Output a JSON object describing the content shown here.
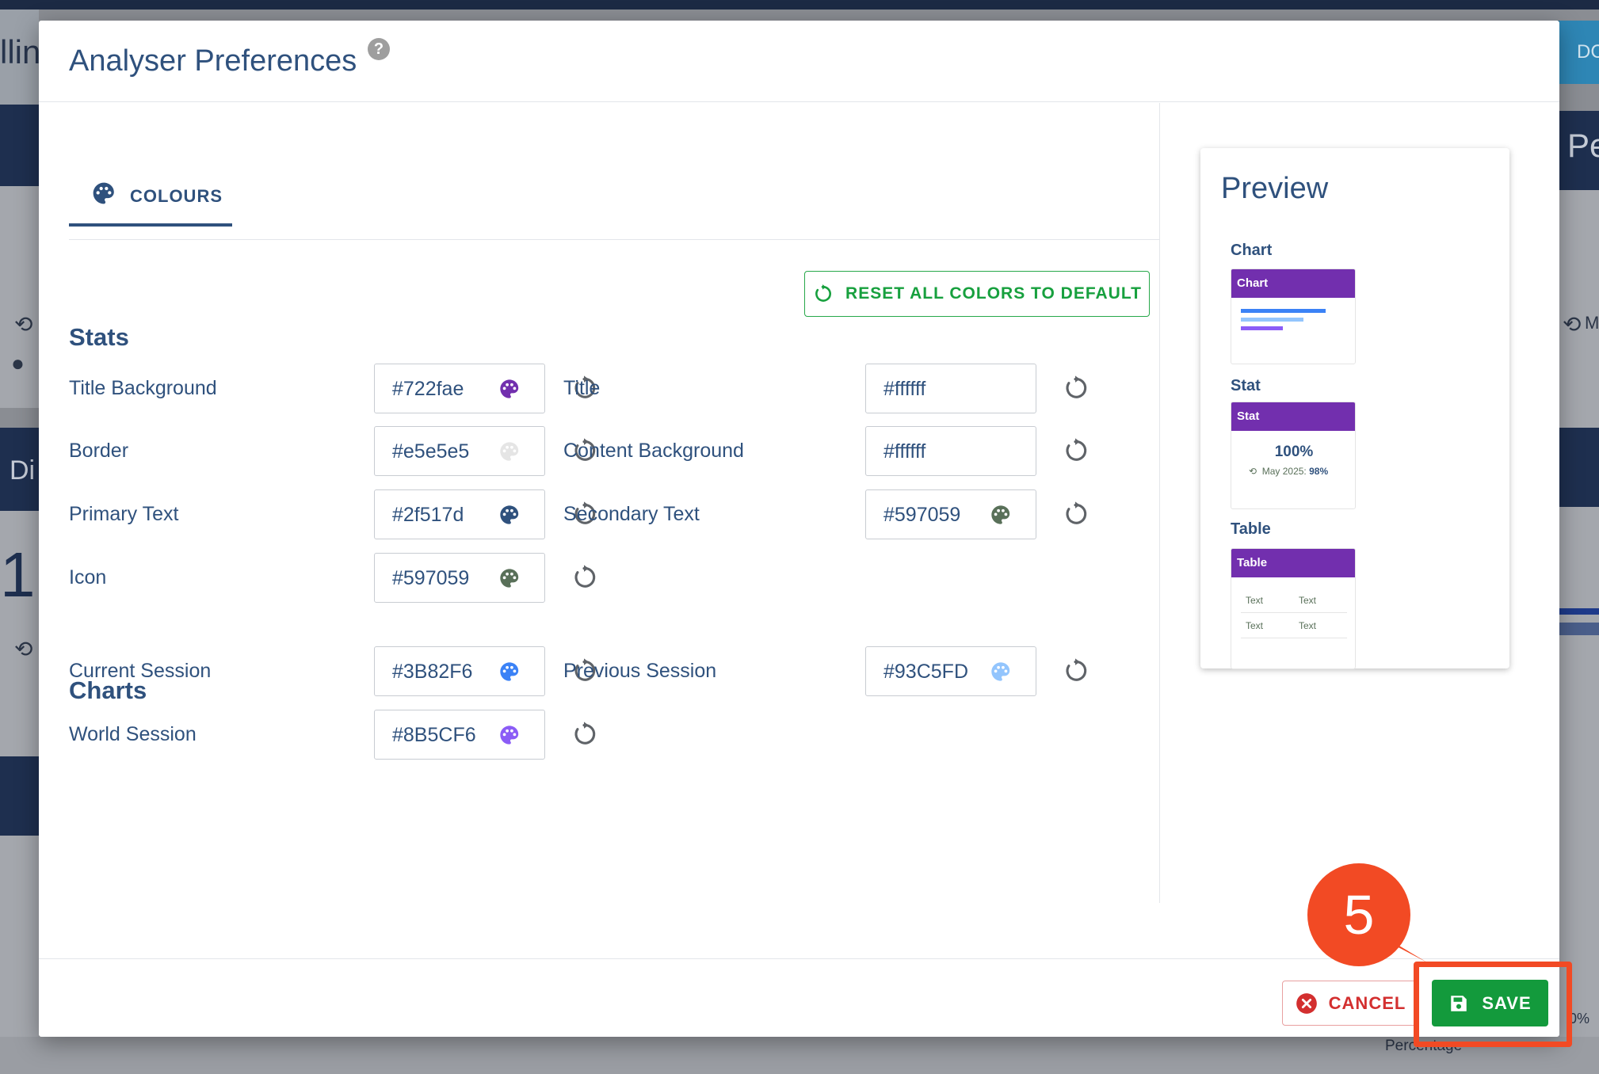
{
  "background": {
    "fragments": [
      "lline",
      "DC",
      "Pe",
      "Di",
      "1",
      "M",
      "0%",
      "Percentage"
    ]
  },
  "modal": {
    "title": "Analyser Preferences",
    "help_icon": "question-circle-icon",
    "tab": {
      "label": "COLOURS",
      "icon": "palette-icon"
    },
    "reset_all_label": "RESET ALL COLORS TO DEFAULT",
    "sections": {
      "stats": {
        "title": "Stats",
        "fields": [
          {
            "label": "Title Background",
            "value": "#722fae",
            "swatch": "#722fae"
          },
          {
            "label": "Title",
            "value": "#ffffff",
            "swatch": "#ffffff"
          },
          {
            "label": "Border",
            "value": "#e5e5e5",
            "swatch": "#e5e5e5"
          },
          {
            "label": "Content Background",
            "value": "#ffffff",
            "swatch": "#ffffff"
          },
          {
            "label": "Primary Text",
            "value": "#2f517d",
            "swatch": "#2f517d"
          },
          {
            "label": "Secondary Text",
            "value": "#597059",
            "swatch": "#597059"
          },
          {
            "label": "Icon",
            "value": "#597059",
            "swatch": "#597059"
          }
        ]
      },
      "charts": {
        "title": "Charts",
        "fields": [
          {
            "label": "Current Session",
            "value": "#3B82F6",
            "swatch": "#3B82F6"
          },
          {
            "label": "Previous Session",
            "value": "#93C5FD",
            "swatch": "#93C5FD"
          },
          {
            "label": "World Session",
            "value": "#8B5CF6",
            "swatch": "#8B5CF6"
          }
        ]
      }
    },
    "preview": {
      "title": "Preview",
      "chart": {
        "label": "Chart",
        "header": "Chart"
      },
      "stat": {
        "label": "Stat",
        "header": "Stat",
        "value": "100%",
        "sub_label": "May 2025:",
        "sub_value": "98%"
      },
      "table": {
        "label": "Table",
        "header": "Table",
        "cells": [
          "Text",
          "Text",
          "Text",
          "Text"
        ]
      }
    },
    "footer": {
      "cancel_label": "CANCEL",
      "save_label": "SAVE"
    }
  },
  "callout": {
    "number": "5",
    "color": "#f24a24"
  }
}
